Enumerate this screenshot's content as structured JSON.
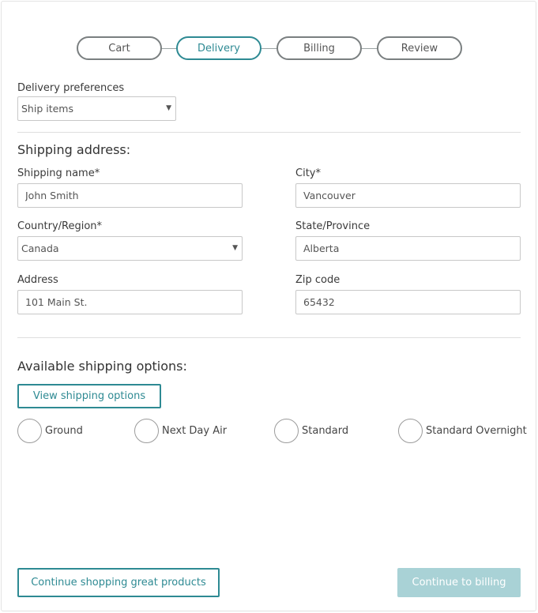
{
  "stepper": {
    "steps": [
      {
        "label": "Cart",
        "active": false
      },
      {
        "label": "Delivery",
        "active": true
      },
      {
        "label": "Billing",
        "active": false
      },
      {
        "label": "Review",
        "active": false
      }
    ]
  },
  "delivery": {
    "label": "Delivery preferences",
    "selected": "Ship items"
  },
  "shipping_address": {
    "title": "Shipping address:",
    "name": {
      "label": "Shipping name*",
      "value": "John Smith"
    },
    "city": {
      "label": "City*",
      "value": "Vancouver"
    },
    "country": {
      "label": "Country/Region*",
      "value": "Canada"
    },
    "state": {
      "label": "State/Province",
      "value": "Alberta"
    },
    "address": {
      "label": "Address",
      "value": "101 Main St."
    },
    "zip": {
      "label": "Zip code",
      "value": "65432"
    }
  },
  "shipping_options": {
    "title": "Available shipping options:",
    "view_button": "View shipping options",
    "options": [
      "Ground",
      "Next Day Air",
      "Standard",
      "Standard Overnight"
    ]
  },
  "footer": {
    "continue_shopping": "Continue shopping great products",
    "continue_billing": "Continue to billing"
  },
  "colors": {
    "accent": "#2e8a93",
    "disabled_button": "#a9d2d6"
  }
}
